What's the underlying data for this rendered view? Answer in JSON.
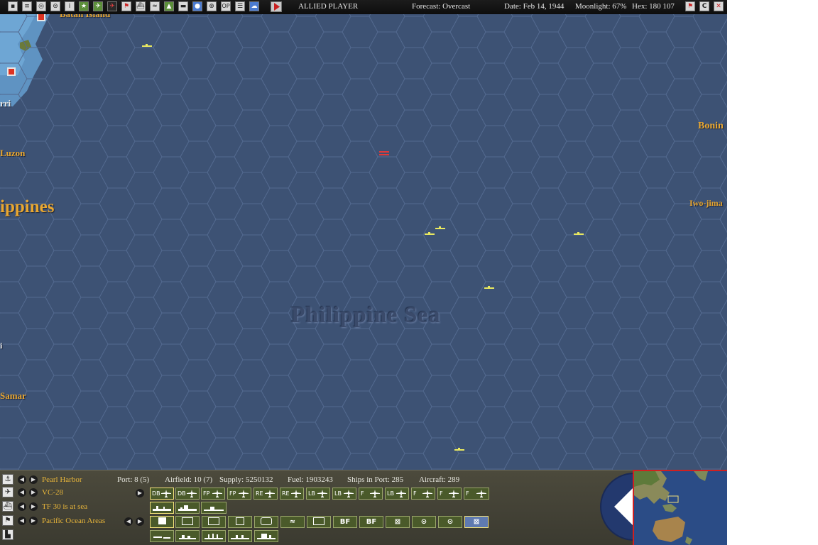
{
  "topbar": {
    "player": "ALLIED PLAYER",
    "forecast": "Forecast: Overcast",
    "date": "Date: Feb 14, 1944",
    "moonlight": "Moonlight: 67%",
    "hex": "Hex: 180 107",
    "tool_icons": [
      "pause-icon",
      "report-icon",
      "cycle-icon",
      "unit-list-icon",
      "info-icon",
      "star-icon",
      "air-unit-icon",
      "air-group-icon",
      "flag-icon",
      "ship-icon",
      "route-icon",
      "land-unit-icon",
      "base-icon",
      "globe-icon",
      "search-icon",
      "op-icon",
      "list-icon",
      "cloud-icon"
    ],
    "op_label": "OP",
    "info_label": "i",
    "right_c_label": "C"
  },
  "map": {
    "places": {
      "batan": "Batan Island",
      "rri": "rri",
      "luzon": "Luzon",
      "philippines": "ippines",
      "bonin": "Bonin",
      "iwo_jima": "Iwo-jima",
      "i_label": "i",
      "samar": "Samar"
    },
    "sea_label": "Philippine Sea"
  },
  "panel": {
    "base_row": {
      "label": "Pearl Harbor",
      "port": "Port: 8 (5)",
      "airfield": "Airfield: 10 (7)",
      "supply": "Supply: 5250132",
      "fuel": "Fuel: 1903243",
      "ships_in_port": "Ships in Port: 285",
      "aircraft": "Aircraft: 289"
    },
    "air_row": {
      "label": "VC-28",
      "aircraft_types": [
        "DB",
        "DB",
        "FP",
        "FP",
        "RE",
        "RE",
        "LB",
        "LB",
        "F",
        "LB",
        "F",
        "F",
        "F"
      ]
    },
    "taskforce_row": {
      "label": "TF 30 is at sea"
    },
    "hq_row": {
      "label": "Pacific Ocean Areas",
      "loc_buttons": [
        "",
        "",
        "",
        "",
        "",
        "",
        "",
        "BF",
        "BF",
        "",
        "",
        "",
        ""
      ]
    }
  },
  "colors": {
    "ocean": "#3d5274",
    "hex_line": "#536a90",
    "land_shallow": "#6ea6d4",
    "place_label": "#e9a730",
    "panel": "#4c4a3c",
    "minimap_border": "#d02020"
  }
}
